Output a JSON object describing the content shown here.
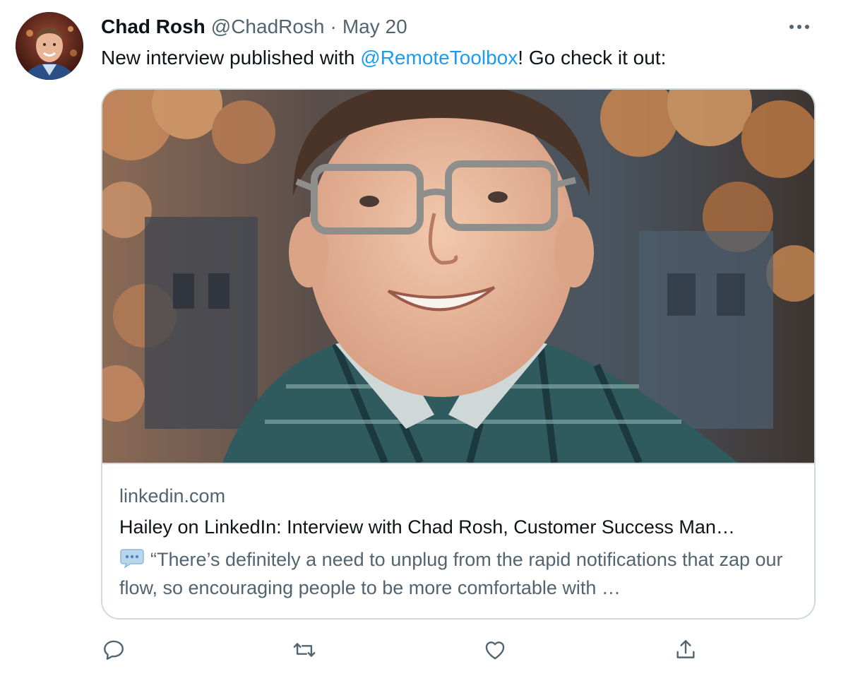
{
  "tweet": {
    "name": "Chad Rosh",
    "handle": "@ChadRosh",
    "separator": "·",
    "date": "May 20",
    "text_before": "New interview published with ",
    "mention": "@RemoteToolbox",
    "text_after": "! Go check it out:"
  },
  "card": {
    "domain": "linkedin.com",
    "title": "Hailey on LinkedIn: Interview with Chad Rosh, Customer Success Man…",
    "description": "“There’s definitely a need to unplug from the rapid notifications that zap our flow, so encouraging people to be more comfortable with …"
  },
  "icons": {
    "more": "more-icon",
    "reply": "reply-icon",
    "retweet": "retweet-icon",
    "like": "like-icon",
    "share": "share-icon",
    "speech_bubble": "speech-bubble-icon"
  },
  "colors": {
    "accent": "#1d9bf0",
    "text": "#0f1419",
    "secondary": "#536471",
    "border": "#cfd9de"
  }
}
